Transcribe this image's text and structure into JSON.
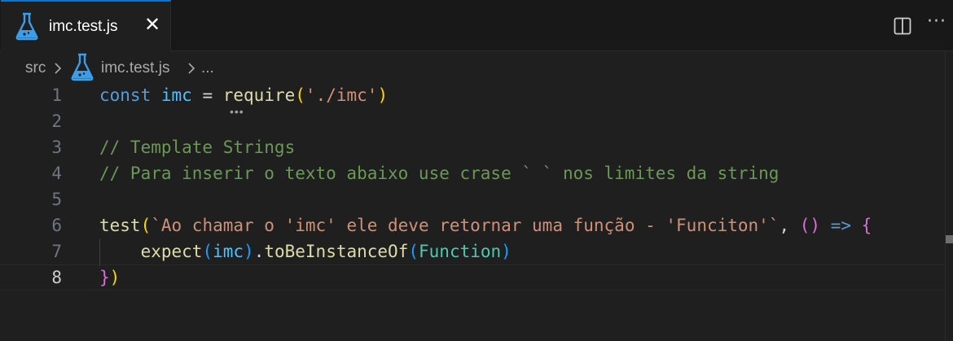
{
  "tab": {
    "label": "imc.test.js",
    "close_glyph": "✕",
    "icon": "flask-icon"
  },
  "actions": {
    "split_icon": "split-editor-icon",
    "more_glyph": "···"
  },
  "breadcrumb": {
    "folder": "src",
    "file": "imc.test.js",
    "symbol": "..."
  },
  "colors": {
    "accent": "#0078d4",
    "background": "#1f1f1f",
    "keyword": "#569cd6",
    "string": "#ce9178",
    "comment": "#6a9955",
    "function": "#dcdcaa"
  },
  "editor": {
    "active_line": "8",
    "lines": [
      {
        "number": "1",
        "tokens": [
          {
            "text": "const",
            "kind": "kw"
          },
          {
            "text": " ",
            "kind": "op"
          },
          {
            "text": "imc",
            "kind": "const"
          },
          {
            "text": " = ",
            "kind": "op"
          },
          {
            "text": "require",
            "kind": "fn"
          },
          {
            "text": "(",
            "kind": "p1"
          },
          {
            "text": "'./imc'",
            "kind": "str"
          },
          {
            "text": ")",
            "kind": "p1"
          }
        ]
      },
      {
        "number": "2",
        "tokens": []
      },
      {
        "number": "3",
        "tokens": [
          {
            "text": "// Template Strings",
            "kind": "cmt"
          }
        ]
      },
      {
        "number": "4",
        "tokens": [
          {
            "text": "// Para inserir o texto abaixo use crase ` ` nos limites da string",
            "kind": "cmt"
          }
        ]
      },
      {
        "number": "5",
        "tokens": []
      },
      {
        "number": "6",
        "tokens": [
          {
            "text": "test",
            "kind": "fn"
          },
          {
            "text": "(",
            "kind": "p1"
          },
          {
            "text": "`Ao chamar o 'imc' ele deve retornar uma função - 'Funciton'`",
            "kind": "str"
          },
          {
            "text": ", ",
            "kind": "op"
          },
          {
            "text": "()",
            "kind": "p2"
          },
          {
            "text": " ",
            "kind": "op"
          },
          {
            "text": "=>",
            "kind": "kw"
          },
          {
            "text": " ",
            "kind": "op"
          },
          {
            "text": "{",
            "kind": "p2"
          }
        ]
      },
      {
        "number": "7",
        "tokens": [
          {
            "text": "    ",
            "kind": "op"
          },
          {
            "text": "expect",
            "kind": "fn"
          },
          {
            "text": "(",
            "kind": "p3"
          },
          {
            "text": "imc",
            "kind": "const"
          },
          {
            "text": ")",
            "kind": "p3"
          },
          {
            "text": ".",
            "kind": "op"
          },
          {
            "text": "toBeInstanceOf",
            "kind": "fn"
          },
          {
            "text": "(",
            "kind": "p3"
          },
          {
            "text": "Function",
            "kind": "type"
          },
          {
            "text": ")",
            "kind": "p3"
          }
        ]
      },
      {
        "number": "8",
        "tokens": [
          {
            "text": "}",
            "kind": "p2"
          },
          {
            "text": ")",
            "kind": "p1"
          }
        ]
      }
    ]
  }
}
